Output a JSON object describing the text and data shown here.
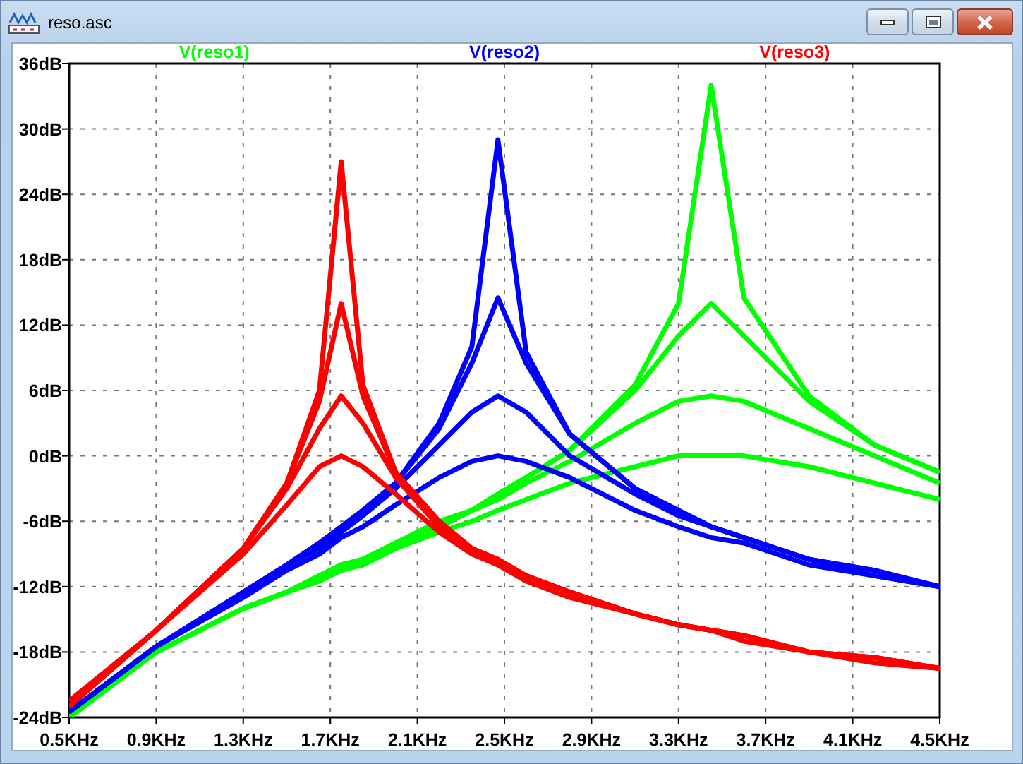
{
  "window": {
    "title": "reso.asc"
  },
  "plot": {
    "chart_data": {
      "type": "line",
      "grid": true,
      "xlim": [
        0.5,
        4.5
      ],
      "ylim": [
        -24,
        36
      ],
      "x": [
        0.5,
        0.9,
        1.3,
        1.5,
        1.65,
        1.75,
        1.85,
        2.0,
        2.2,
        2.35,
        2.47,
        2.6,
        2.8,
        3.1,
        3.3,
        3.45,
        3.6,
        3.9,
        4.2,
        4.5
      ],
      "xticks": [
        {
          "value": 0.5,
          "label": "0.5KHz"
        },
        {
          "value": 0.9,
          "label": "0.9KHz"
        },
        {
          "value": 1.3,
          "label": "1.3KHz"
        },
        {
          "value": 1.7,
          "label": "1.7KHz"
        },
        {
          "value": 2.1,
          "label": "2.1KHz"
        },
        {
          "value": 2.5,
          "label": "2.5KHz"
        },
        {
          "value": 2.9,
          "label": "2.9KHz"
        },
        {
          "value": 3.3,
          "label": "3.3KHz"
        },
        {
          "value": 3.7,
          "label": "3.7KHz"
        },
        {
          "value": 4.1,
          "label": "4.1KHz"
        },
        {
          "value": 4.5,
          "label": "4.5KHz"
        }
      ],
      "yticks": [
        {
          "value": 36,
          "label": "36dB"
        },
        {
          "value": 30,
          "label": "30dB"
        },
        {
          "value": 24,
          "label": "24dB"
        },
        {
          "value": 18,
          "label": "18dB"
        },
        {
          "value": 12,
          "label": "12dB"
        },
        {
          "value": 6,
          "label": "6dB"
        },
        {
          "value": 0,
          "label": "0dB"
        },
        {
          "value": -6,
          "label": "-6dB"
        },
        {
          "value": -12,
          "label": "-12dB"
        },
        {
          "value": -18,
          "label": "-18dB"
        },
        {
          "value": -24,
          "label": "-24dB"
        }
      ],
      "series": [
        {
          "name": "V(reso1)",
          "color": "#00ff00",
          "values": [
            -23.5,
            -18,
            -14,
            -12.5,
            -11,
            -10,
            -9.5,
            -8,
            -6,
            -5,
            -3.5,
            -2,
            0.5,
            6.5,
            14,
            34,
            14.5,
            5.5,
            1,
            -1.5
          ]
        },
        {
          "color": "#00ff00",
          "values": [
            -23.5,
            -18,
            -14,
            -12.5,
            -11,
            -10,
            -9.5,
            -8,
            -6.5,
            -5,
            -3.5,
            -2,
            0.5,
            6,
            11,
            14,
            11,
            5,
            1,
            -1.5
          ]
        },
        {
          "color": "#00ff00",
          "values": [
            -24,
            -18,
            -14,
            -12.5,
            -11,
            -10.5,
            -9.5,
            -8.5,
            -6.5,
            -5,
            -4,
            -2.5,
            -0.5,
            3,
            5,
            5.5,
            5,
            2.5,
            0,
            -2.5
          ]
        },
        {
          "color": "#00ff00",
          "values": [
            -24,
            -18,
            -14,
            -12.5,
            -11.5,
            -10.5,
            -10,
            -8.5,
            -7,
            -6,
            -5,
            -4,
            -2.5,
            -1,
            0,
            0,
            0,
            -1,
            -2.5,
            -4
          ]
        },
        {
          "name": "V(reso2)",
          "color": "#0000ff",
          "values": [
            -23.5,
            -17.5,
            -12.5,
            -10,
            -8,
            -6.5,
            -5,
            -2.5,
            3,
            10,
            29,
            9.5,
            2,
            -3,
            -5,
            -6.5,
            -7.5,
            -9.5,
            -10.5,
            -12
          ]
        },
        {
          "color": "#0000ff",
          "values": [
            -23.5,
            -17.5,
            -12.5,
            -10,
            -8,
            -6.5,
            -5,
            -2.5,
            2.5,
            8.5,
            14.5,
            8.5,
            2,
            -3,
            -5,
            -6.5,
            -7.5,
            -9.5,
            -10.5,
            -12
          ]
        },
        {
          "color": "#0000ff",
          "values": [
            -23.5,
            -17.5,
            -12.5,
            -10,
            -8.5,
            -7,
            -5.5,
            -3,
            1,
            4,
            5.5,
            4,
            0,
            -3.5,
            -5.5,
            -6.5,
            -7.5,
            -9.5,
            -11,
            -12
          ]
        },
        {
          "color": "#0000ff",
          "values": [
            -23.5,
            -17.5,
            -13,
            -10.5,
            -9,
            -7.5,
            -6.5,
            -4.5,
            -2,
            -0.5,
            0,
            -0.5,
            -2,
            -5,
            -6.5,
            -7.5,
            -8,
            -10,
            -11,
            -12
          ]
        },
        {
          "name": "V(reso3)",
          "color": "#ff0000",
          "values": [
            -23,
            -16,
            -8.5,
            -2.5,
            6,
            27,
            6.5,
            -1.5,
            -6,
            -8.5,
            -9.5,
            -11,
            -12.5,
            -14.5,
            -15.5,
            -16,
            -16.5,
            -18,
            -18.5,
            -19.5
          ]
        },
        {
          "color": "#ff0000",
          "values": [
            -23,
            -16,
            -8.5,
            -2.5,
            5,
            14,
            5.5,
            -1.5,
            -6,
            -8.5,
            -9.5,
            -11,
            -12.5,
            -14.5,
            -15.5,
            -16,
            -16.5,
            -18,
            -18.5,
            -19.5
          ]
        },
        {
          "color": "#ff0000",
          "values": [
            -23,
            -16,
            -8.5,
            -3,
            2.5,
            5.5,
            3,
            -2,
            -6.5,
            -8.5,
            -10,
            -11,
            -12.5,
            -14.5,
            -15.5,
            -16,
            -16.5,
            -18,
            -18.5,
            -19.5
          ]
        },
        {
          "color": "#ff0000",
          "values": [
            -22.5,
            -16,
            -9,
            -4.5,
            -1,
            0,
            -1,
            -3.5,
            -7,
            -9,
            -10,
            -11.5,
            -13,
            -14.5,
            -15.5,
            -16,
            -17,
            -18,
            -19,
            -19.5
          ]
        }
      ]
    }
  }
}
